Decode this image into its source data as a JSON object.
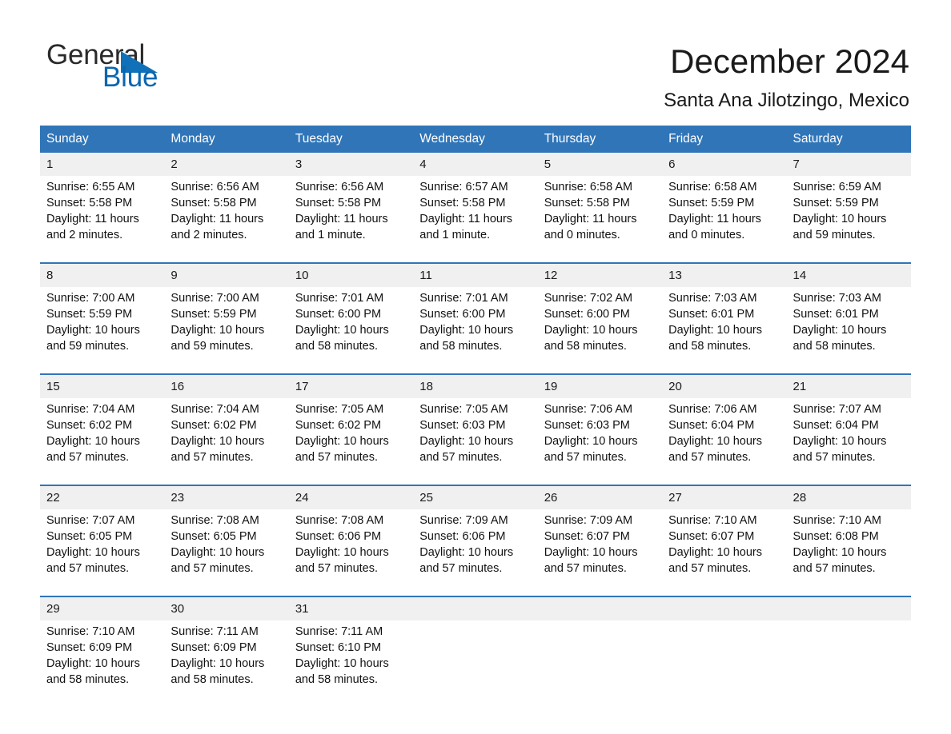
{
  "brand": {
    "word1": "General",
    "word2": "Blue",
    "flag_icon": "triangle-flag-icon",
    "flag_color": "#1071b8"
  },
  "header": {
    "month_title": "December 2024",
    "location": "Santa Ana Jilotzingo, Mexico"
  },
  "theme": {
    "header_blue": "#3075b8",
    "row_separator_blue": "#3075b8",
    "daynum_band": "#f0f0f0",
    "text": "#111111"
  },
  "calendar": {
    "weekdays": [
      "Sunday",
      "Monday",
      "Tuesday",
      "Wednesday",
      "Thursday",
      "Friday",
      "Saturday"
    ],
    "weeks": [
      {
        "days": [
          {
            "date": "1",
            "sunrise": "Sunrise: 6:55 AM",
            "sunset": "Sunset: 5:58 PM",
            "daylight_l1": "Daylight: 11 hours",
            "daylight_l2": "and 2 minutes."
          },
          {
            "date": "2",
            "sunrise": "Sunrise: 6:56 AM",
            "sunset": "Sunset: 5:58 PM",
            "daylight_l1": "Daylight: 11 hours",
            "daylight_l2": "and 2 minutes."
          },
          {
            "date": "3",
            "sunrise": "Sunrise: 6:56 AM",
            "sunset": "Sunset: 5:58 PM",
            "daylight_l1": "Daylight: 11 hours",
            "daylight_l2": "and 1 minute."
          },
          {
            "date": "4",
            "sunrise": "Sunrise: 6:57 AM",
            "sunset": "Sunset: 5:58 PM",
            "daylight_l1": "Daylight: 11 hours",
            "daylight_l2": "and 1 minute."
          },
          {
            "date": "5",
            "sunrise": "Sunrise: 6:58 AM",
            "sunset": "Sunset: 5:58 PM",
            "daylight_l1": "Daylight: 11 hours",
            "daylight_l2": "and 0 minutes."
          },
          {
            "date": "6",
            "sunrise": "Sunrise: 6:58 AM",
            "sunset": "Sunset: 5:59 PM",
            "daylight_l1": "Daylight: 11 hours",
            "daylight_l2": "and 0 minutes."
          },
          {
            "date": "7",
            "sunrise": "Sunrise: 6:59 AM",
            "sunset": "Sunset: 5:59 PM",
            "daylight_l1": "Daylight: 10 hours",
            "daylight_l2": "and 59 minutes."
          }
        ]
      },
      {
        "days": [
          {
            "date": "8",
            "sunrise": "Sunrise: 7:00 AM",
            "sunset": "Sunset: 5:59 PM",
            "daylight_l1": "Daylight: 10 hours",
            "daylight_l2": "and 59 minutes."
          },
          {
            "date": "9",
            "sunrise": "Sunrise: 7:00 AM",
            "sunset": "Sunset: 5:59 PM",
            "daylight_l1": "Daylight: 10 hours",
            "daylight_l2": "and 59 minutes."
          },
          {
            "date": "10",
            "sunrise": "Sunrise: 7:01 AM",
            "sunset": "Sunset: 6:00 PM",
            "daylight_l1": "Daylight: 10 hours",
            "daylight_l2": "and 58 minutes."
          },
          {
            "date": "11",
            "sunrise": "Sunrise: 7:01 AM",
            "sunset": "Sunset: 6:00 PM",
            "daylight_l1": "Daylight: 10 hours",
            "daylight_l2": "and 58 minutes."
          },
          {
            "date": "12",
            "sunrise": "Sunrise: 7:02 AM",
            "sunset": "Sunset: 6:00 PM",
            "daylight_l1": "Daylight: 10 hours",
            "daylight_l2": "and 58 minutes."
          },
          {
            "date": "13",
            "sunrise": "Sunrise: 7:03 AM",
            "sunset": "Sunset: 6:01 PM",
            "daylight_l1": "Daylight: 10 hours",
            "daylight_l2": "and 58 minutes."
          },
          {
            "date": "14",
            "sunrise": "Sunrise: 7:03 AM",
            "sunset": "Sunset: 6:01 PM",
            "daylight_l1": "Daylight: 10 hours",
            "daylight_l2": "and 58 minutes."
          }
        ]
      },
      {
        "days": [
          {
            "date": "15",
            "sunrise": "Sunrise: 7:04 AM",
            "sunset": "Sunset: 6:02 PM",
            "daylight_l1": "Daylight: 10 hours",
            "daylight_l2": "and 57 minutes."
          },
          {
            "date": "16",
            "sunrise": "Sunrise: 7:04 AM",
            "sunset": "Sunset: 6:02 PM",
            "daylight_l1": "Daylight: 10 hours",
            "daylight_l2": "and 57 minutes."
          },
          {
            "date": "17",
            "sunrise": "Sunrise: 7:05 AM",
            "sunset": "Sunset: 6:02 PM",
            "daylight_l1": "Daylight: 10 hours",
            "daylight_l2": "and 57 minutes."
          },
          {
            "date": "18",
            "sunrise": "Sunrise: 7:05 AM",
            "sunset": "Sunset: 6:03 PM",
            "daylight_l1": "Daylight: 10 hours",
            "daylight_l2": "and 57 minutes."
          },
          {
            "date": "19",
            "sunrise": "Sunrise: 7:06 AM",
            "sunset": "Sunset: 6:03 PM",
            "daylight_l1": "Daylight: 10 hours",
            "daylight_l2": "and 57 minutes."
          },
          {
            "date": "20",
            "sunrise": "Sunrise: 7:06 AM",
            "sunset": "Sunset: 6:04 PM",
            "daylight_l1": "Daylight: 10 hours",
            "daylight_l2": "and 57 minutes."
          },
          {
            "date": "21",
            "sunrise": "Sunrise: 7:07 AM",
            "sunset": "Sunset: 6:04 PM",
            "daylight_l1": "Daylight: 10 hours",
            "daylight_l2": "and 57 minutes."
          }
        ]
      },
      {
        "days": [
          {
            "date": "22",
            "sunrise": "Sunrise: 7:07 AM",
            "sunset": "Sunset: 6:05 PM",
            "daylight_l1": "Daylight: 10 hours",
            "daylight_l2": "and 57 minutes."
          },
          {
            "date": "23",
            "sunrise": "Sunrise: 7:08 AM",
            "sunset": "Sunset: 6:05 PM",
            "daylight_l1": "Daylight: 10 hours",
            "daylight_l2": "and 57 minutes."
          },
          {
            "date": "24",
            "sunrise": "Sunrise: 7:08 AM",
            "sunset": "Sunset: 6:06 PM",
            "daylight_l1": "Daylight: 10 hours",
            "daylight_l2": "and 57 minutes."
          },
          {
            "date": "25",
            "sunrise": "Sunrise: 7:09 AM",
            "sunset": "Sunset: 6:06 PM",
            "daylight_l1": "Daylight: 10 hours",
            "daylight_l2": "and 57 minutes."
          },
          {
            "date": "26",
            "sunrise": "Sunrise: 7:09 AM",
            "sunset": "Sunset: 6:07 PM",
            "daylight_l1": "Daylight: 10 hours",
            "daylight_l2": "and 57 minutes."
          },
          {
            "date": "27",
            "sunrise": "Sunrise: 7:10 AM",
            "sunset": "Sunset: 6:07 PM",
            "daylight_l1": "Daylight: 10 hours",
            "daylight_l2": "and 57 minutes."
          },
          {
            "date": "28",
            "sunrise": "Sunrise: 7:10 AM",
            "sunset": "Sunset: 6:08 PM",
            "daylight_l1": "Daylight: 10 hours",
            "daylight_l2": "and 57 minutes."
          }
        ]
      },
      {
        "days": [
          {
            "date": "29",
            "sunrise": "Sunrise: 7:10 AM",
            "sunset": "Sunset: 6:09 PM",
            "daylight_l1": "Daylight: 10 hours",
            "daylight_l2": "and 58 minutes."
          },
          {
            "date": "30",
            "sunrise": "Sunrise: 7:11 AM",
            "sunset": "Sunset: 6:09 PM",
            "daylight_l1": "Daylight: 10 hours",
            "daylight_l2": "and 58 minutes."
          },
          {
            "date": "31",
            "sunrise": "Sunrise: 7:11 AM",
            "sunset": "Sunset: 6:10 PM",
            "daylight_l1": "Daylight: 10 hours",
            "daylight_l2": "and 58 minutes."
          },
          {
            "date": "",
            "sunrise": "",
            "sunset": "",
            "daylight_l1": "",
            "daylight_l2": ""
          },
          {
            "date": "",
            "sunrise": "",
            "sunset": "",
            "daylight_l1": "",
            "daylight_l2": ""
          },
          {
            "date": "",
            "sunrise": "",
            "sunset": "",
            "daylight_l1": "",
            "daylight_l2": ""
          },
          {
            "date": "",
            "sunrise": "",
            "sunset": "",
            "daylight_l1": "",
            "daylight_l2": ""
          }
        ]
      }
    ]
  }
}
